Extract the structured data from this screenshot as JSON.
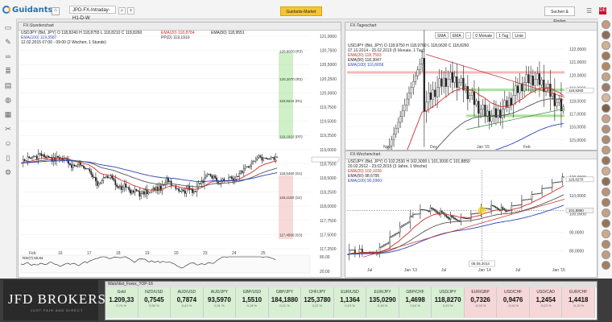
{
  "app": {
    "logo": "Guidants",
    "tab_label": "JPD-FX-Intraday-H1-D-W",
    "orange_button": "Guidants-Market",
    "find_button": "Suchen & Finden",
    "flag": "DE"
  },
  "panel_main": {
    "title": "FX-Stundenchart",
    "legend": [
      "USDJPY (Bid, JPY)  O 118,8240  H 118,8755  L 118,8210  C 118,8260",
      "EMA(100) 119,3587",
      "12.02.2015 07:00 - 09:00 (2 Wochen, 1 Stunde)"
    ],
    "legend_ma": [
      "EMA(20) 118,8784",
      "EMA(50) 118,9551",
      "PP(D) 119,1910"
    ],
    "price_axis": [
      "121,0000",
      "120,7500",
      "120,5000",
      "120,2500",
      "120,0000",
      "119,7500",
      "119,5000",
      "119,2500",
      "119,0000",
      "118,7500",
      "118,5000",
      "118,2500",
      "118,0000",
      "117,7500",
      "117,5000",
      "117,2500"
    ],
    "pivots": [
      {
        "label": "120,6970 (R3)",
        "kind": "r"
      },
      {
        "label": "120,2070 (R2)",
        "kind": "r"
      },
      {
        "label": "119,8210 (R1)",
        "kind": "r"
      },
      {
        "label": "119,1910 (PP)",
        "kind": "r"
      },
      {
        "label": "118,5460 (S1)",
        "kind": "s"
      },
      {
        "label": "118,1150 (S2)",
        "kind": "s"
      },
      {
        "label": "117,4590 (S3)",
        "kind": "s"
      }
    ],
    "x_labels": [
      "Feb",
      "16",
      "17",
      "18",
      "19",
      "20",
      "23",
      "24",
      "25"
    ],
    "rsi_label": "RSI(7) 50,84",
    "rsi_axis": [
      "80,00",
      "20,00"
    ]
  },
  "panel_daily": {
    "title": "FX-Tageschart",
    "legend": [
      "USDJPY (Bid, JPY)  O 118,9750  H 118,9760  L 118,0630  C 118,8260",
      "07.10.2014 - 25.02.2015 (5 Monate, 1 Tag)",
      "EMA(20) 118,7593",
      "EMA(50) 118,3047",
      "EMA(100) 116,6656"
    ],
    "toolbar": [
      "SMA",
      "EMA",
      "-",
      "0 Monate",
      "1 Tag",
      "Linie"
    ],
    "price_axis": [
      "122,0000",
      "121,0000",
      "120,0000",
      "119,0000",
      "118,0000",
      "117,0000",
      "116,0000",
      "115,0000"
    ],
    "current_label": "118,8260",
    "x_labels": [
      "Nov",
      "Dez",
      "Jan '15",
      "Feb"
    ]
  },
  "panel_weekly": {
    "title": "FX-Wochenchart",
    "legend": [
      "USDJPY (Bid, JPY)  O 102,2530  H 102,3000  L 101,3000  C 101,8850",
      "20.02.2012 - 23.02.2015 (3 Jahre, 1 Woche)",
      "EMA(20) 102,1036",
      "EMA(50) 98,6795",
      "EMA(100) 90,0360"
    ],
    "price_axis": [
      "120,0000",
      "110,0000",
      "100,0000",
      "90,0000",
      "80,0000"
    ],
    "current_label": "118,8270",
    "secondary_label": "101,8850",
    "crosshair_label": "05.05.2014",
    "x_labels": [
      "Jul",
      "Jan '13",
      "Jul",
      "Jan '14",
      "Jul",
      "Jan '15"
    ]
  },
  "broker": {
    "name": "JFD BROKERS",
    "tagline": "JUST FAIR AND DIRECT"
  },
  "ticker": {
    "header": "Watchlist_Forex_TOP-16",
    "items": [
      {
        "name": "Gold",
        "value": "1.209,33",
        "pct": "0,74 %",
        "trend": "pos"
      },
      {
        "name": "NZD/USD",
        "value": "0,7545",
        "pct": "0,35 %",
        "trend": "pos"
      },
      {
        "name": "AUD/USD",
        "value": "0,7874",
        "pct": "0,41 %",
        "trend": "pos"
      },
      {
        "name": "AUD/JPY",
        "value": "93,5970",
        "pct": "0,51 %",
        "trend": "pos"
      },
      {
        "name": "GBP/USD",
        "value": "1,5510",
        "pct": "0,18 %",
        "trend": "pos"
      },
      {
        "name": "GBP/JPY",
        "value": "184,1880",
        "pct": "0,21 %",
        "trend": "pos"
      },
      {
        "name": "CHF/JPY",
        "value": "125,3780",
        "pct": "0,22 %",
        "trend": "pos"
      },
      {
        "name": "EUR/USD",
        "value": "1,1364",
        "pct": "0,15 %",
        "trend": "pos"
      },
      {
        "name": "EUR/JPY",
        "value": "135,0290",
        "pct": "0,18 %",
        "trend": "pos"
      },
      {
        "name": "GBP/CHF",
        "value": "1,4698",
        "pct": "0,04 %",
        "trend": "pos"
      },
      {
        "name": "USD/JPY",
        "value": "118,8270",
        "pct": "0,03 %",
        "trend": "pos"
      },
      {
        "name": "EUR/GBP",
        "value": "0,7326",
        "pct": "-0,03 %",
        "trend": "neg"
      },
      {
        "name": "USD/CHF",
        "value": "0,9476",
        "pct": "-0,14 %",
        "trend": "neg"
      },
      {
        "name": "USD/CAD",
        "value": "1,2454",
        "pct": "-0,23 %",
        "trend": "neg"
      },
      {
        "name": "EUR/CHF",
        "value": "1,4418",
        "pct": "-0,15 %",
        "trend": "neg"
      }
    ]
  },
  "colors": {
    "candle": "#222222",
    "ema20": "#d12b2b",
    "ema50": "#555555",
    "ema100": "#2e44b8",
    "green_zone": "#a9e39b",
    "red_zone": "#f3b9b9",
    "accent": "#f6c533"
  }
}
